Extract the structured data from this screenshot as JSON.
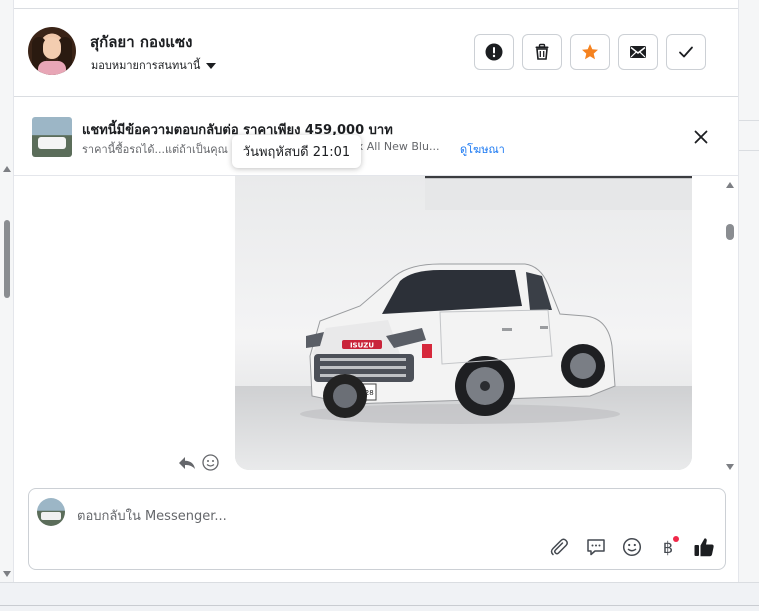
{
  "header": {
    "contact_name": "สุกัลยา กองแซง",
    "assign_label": "มอบหมายการสนทนานี้",
    "actions": [
      {
        "name": "report-button",
        "icon": "exclamation-icon"
      },
      {
        "name": "delete-button",
        "icon": "trash-icon"
      },
      {
        "name": "star-button",
        "icon": "star-icon"
      },
      {
        "name": "mark-unread-button",
        "icon": "envelope-icon"
      },
      {
        "name": "mark-done-button",
        "icon": "check-icon"
      }
    ]
  },
  "ad": {
    "title": "แชทนี้มีข้อความตอบกลับต่อ ราคาเพียง 459,000 บาท",
    "snippet_start": "ราคานี้ซื้อรถได้...แต่ถ้าเป็นคุณ",
    "snippet_end": "ax All New Blu...",
    "link_text": "ดูโฆษณา"
  },
  "tooltip": {
    "text": "วันพฤหัสบดี 21:01"
  },
  "message": {
    "plate_text": "6กฎ 9628"
  },
  "composer": {
    "placeholder": "ตอบกลับใน Messenger...",
    "currency_symbol": "฿"
  },
  "colors": {
    "star": "#f5821f",
    "link": "#1877f2",
    "notification_dot": "#f02849",
    "text_secondary": "#65676b"
  }
}
